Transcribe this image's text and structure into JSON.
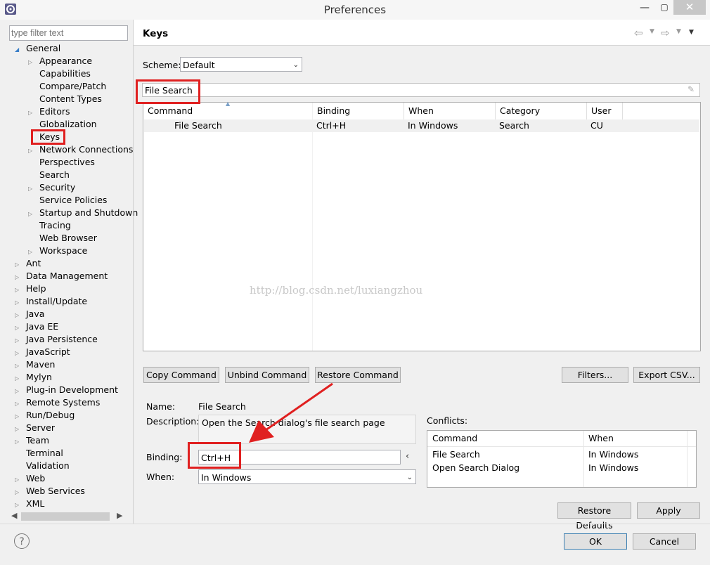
{
  "window": {
    "title": "Preferences",
    "minimize": "—",
    "maximize": "▢",
    "close": "✕"
  },
  "filter": {
    "placeholder": "type filter text"
  },
  "tree": [
    {
      "label": "General",
      "depth": 0,
      "expander": "expanded"
    },
    {
      "label": "Appearance",
      "depth": 1,
      "expander": "collapsed"
    },
    {
      "label": "Capabilities",
      "depth": 1,
      "expander": "none"
    },
    {
      "label": "Compare/Patch",
      "depth": 1,
      "expander": "none"
    },
    {
      "label": "Content Types",
      "depth": 1,
      "expander": "none"
    },
    {
      "label": "Editors",
      "depth": 1,
      "expander": "collapsed"
    },
    {
      "label": "Globalization",
      "depth": 1,
      "expander": "none"
    },
    {
      "label": "Keys",
      "depth": 1,
      "expander": "none",
      "selected": true
    },
    {
      "label": "Network Connections",
      "depth": 1,
      "expander": "collapsed"
    },
    {
      "label": "Perspectives",
      "depth": 1,
      "expander": "none"
    },
    {
      "label": "Search",
      "depth": 1,
      "expander": "none"
    },
    {
      "label": "Security",
      "depth": 1,
      "expander": "collapsed"
    },
    {
      "label": "Service Policies",
      "depth": 1,
      "expander": "none"
    },
    {
      "label": "Startup and Shutdown",
      "depth": 1,
      "expander": "collapsed"
    },
    {
      "label": "Tracing",
      "depth": 1,
      "expander": "none"
    },
    {
      "label": "Web Browser",
      "depth": 1,
      "expander": "none"
    },
    {
      "label": "Workspace",
      "depth": 1,
      "expander": "collapsed"
    },
    {
      "label": "Ant",
      "depth": 0,
      "expander": "collapsed"
    },
    {
      "label": "Data Management",
      "depth": 0,
      "expander": "collapsed"
    },
    {
      "label": "Help",
      "depth": 0,
      "expander": "collapsed"
    },
    {
      "label": "Install/Update",
      "depth": 0,
      "expander": "collapsed"
    },
    {
      "label": "Java",
      "depth": 0,
      "expander": "collapsed"
    },
    {
      "label": "Java EE",
      "depth": 0,
      "expander": "collapsed"
    },
    {
      "label": "Java Persistence",
      "depth": 0,
      "expander": "collapsed"
    },
    {
      "label": "JavaScript",
      "depth": 0,
      "expander": "collapsed"
    },
    {
      "label": "Maven",
      "depth": 0,
      "expander": "collapsed"
    },
    {
      "label": "Mylyn",
      "depth": 0,
      "expander": "collapsed"
    },
    {
      "label": "Plug-in Development",
      "depth": 0,
      "expander": "collapsed"
    },
    {
      "label": "Remote Systems",
      "depth": 0,
      "expander": "collapsed"
    },
    {
      "label": "Run/Debug",
      "depth": 0,
      "expander": "collapsed"
    },
    {
      "label": "Server",
      "depth": 0,
      "expander": "collapsed"
    },
    {
      "label": "Team",
      "depth": 0,
      "expander": "collapsed"
    },
    {
      "label": "Terminal",
      "depth": 0,
      "expander": "none"
    },
    {
      "label": "Validation",
      "depth": 0,
      "expander": "none"
    },
    {
      "label": "Web",
      "depth": 0,
      "expander": "collapsed"
    },
    {
      "label": "Web Services",
      "depth": 0,
      "expander": "collapsed"
    },
    {
      "label": "XML",
      "depth": 0,
      "expander": "collapsed"
    }
  ],
  "page": {
    "title": "Keys"
  },
  "scheme": {
    "label": "Scheme:",
    "value": "Default"
  },
  "search": {
    "value": "File Search"
  },
  "table": {
    "headers": [
      "Command",
      "Binding",
      "When",
      "Category",
      "User"
    ],
    "rows": [
      [
        "File Search",
        "Ctrl+H",
        "In Windows",
        "Search",
        "CU"
      ]
    ]
  },
  "watermark": "http://blog.csdn.net/luxiangzhou",
  "buttons": {
    "copy": "Copy Command",
    "unbind": "Unbind Command",
    "restore": "Restore Command",
    "filters": "Filters...",
    "export": "Export CSV...",
    "restore_defaults": "Restore Defaults",
    "apply": "Apply",
    "ok": "OK",
    "cancel": "Cancel"
  },
  "details": {
    "name_label": "Name:",
    "name_value": "File Search",
    "description_label": "Description:",
    "description_value": "Open the Search dialog's file search page",
    "binding_label": "Binding:",
    "binding_value": "Ctrl+H",
    "when_label": "When:",
    "when_value": "In Windows"
  },
  "conflicts": {
    "label": "Conflicts:",
    "headers": [
      "Command",
      "When"
    ],
    "rows": [
      [
        "File Search",
        "In Windows"
      ],
      [
        "Open Search Dialog",
        "In Windows"
      ]
    ]
  },
  "help": "?",
  "colors": {
    "highlight": "#e02020"
  }
}
